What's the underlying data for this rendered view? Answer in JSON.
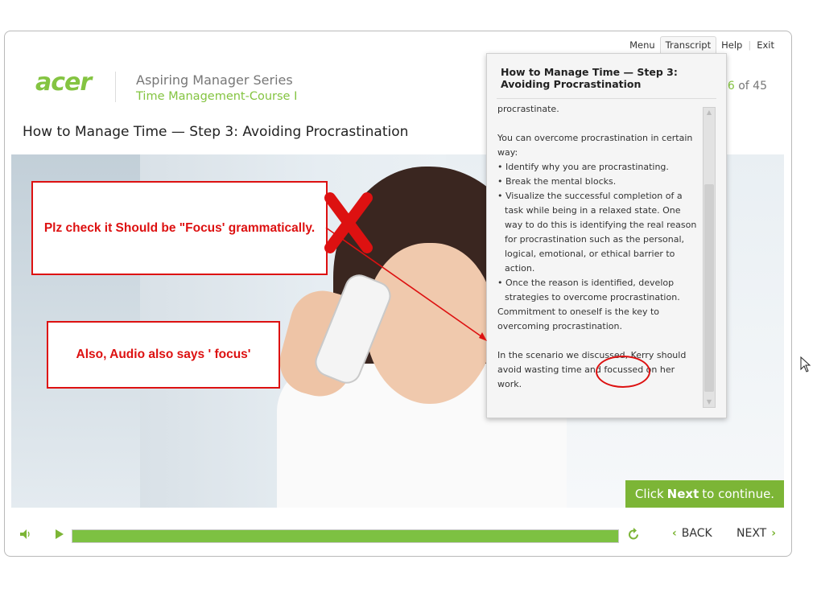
{
  "topnav": {
    "menu": "Menu",
    "transcript": "Transcript",
    "help": "Help",
    "exit": "Exit"
  },
  "brand": {
    "logo": "acer",
    "series": "Aspiring Manager Series",
    "course": "Time Management-Course I"
  },
  "counter": {
    "current": "6",
    "total": "of 45"
  },
  "slide": {
    "title": "How to Manage Time — Step 3: Avoiding Procrastination"
  },
  "annotations": {
    "note1": "Plz check it Should be \"Focus' grammatically.",
    "note2": "Also, Audio also says ' focus'"
  },
  "click_next": {
    "pre": "Click",
    "bold": "Next",
    "post": "to continue."
  },
  "controls": {
    "progress_pct": 100,
    "back": "BACK",
    "next": "NEXT"
  },
  "transcript_panel": {
    "title": "How to Manage Time — Step 3: Avoiding Procrastination",
    "lines": {
      "l0": "procrastinate.",
      "l1": "You can overcome procrastination in certain way:",
      "b1": "• Identify why you are procrastinating.",
      "b2": "• Break the mental blocks.",
      "b3": "• Visualize the successful completion of a task while being in a relaxed state. One way to do this is identifying the real reason for procrastination such as the personal, logical, emotional, or ethical barrier to action.",
      "b4": "• Once the reason is identified, develop strategies to overcome procrastination.",
      "l2": "Commitment to oneself is the key to overcoming procrastination.",
      "l3": "In the scenario we discussed, Kerry should avoid wasting time and focussed on her work."
    }
  },
  "icons": {
    "volume": "speaker-icon",
    "play": "play-icon",
    "replay": "replay-icon"
  },
  "colors": {
    "accent": "#84c441",
    "annotation_red": "#dd1111"
  }
}
